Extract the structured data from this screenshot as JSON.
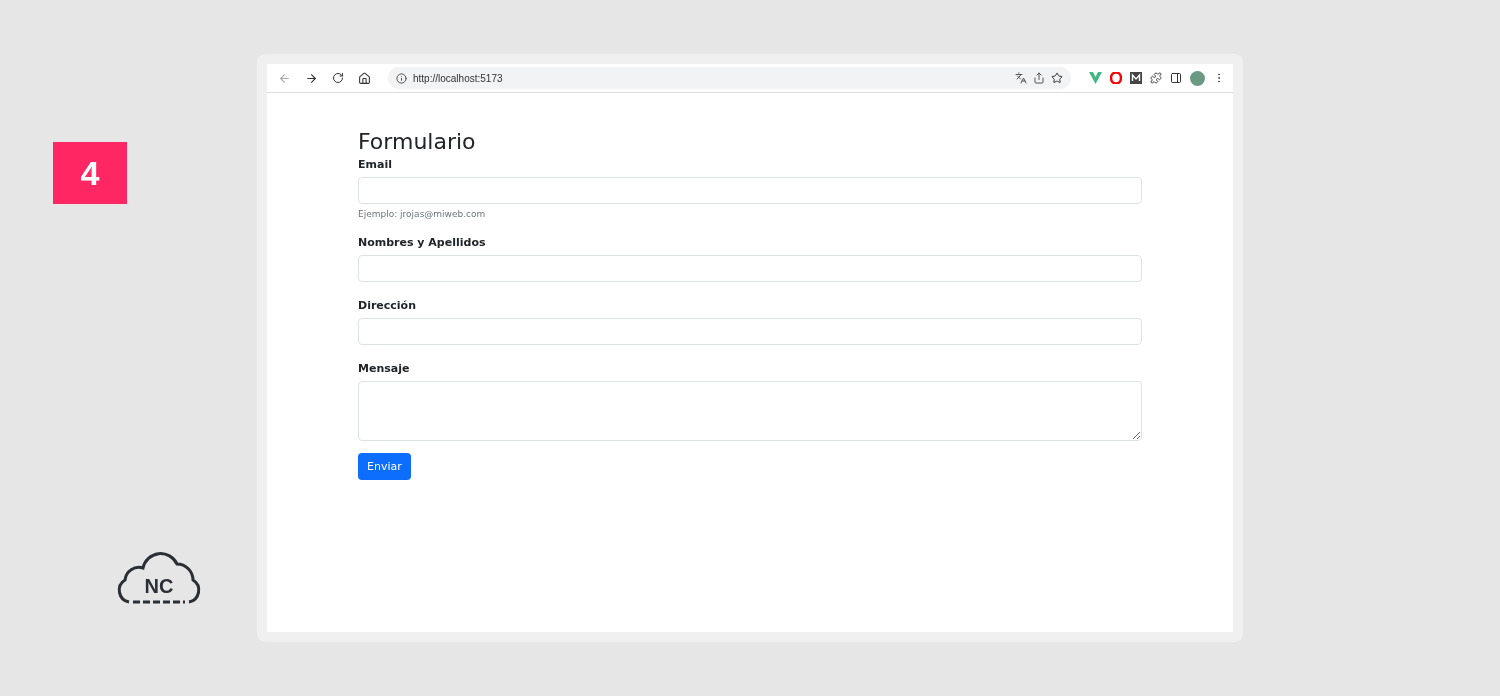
{
  "step_badge": "4",
  "logo": {
    "text": "NC"
  },
  "browser": {
    "url": "http://localhost:5173"
  },
  "form": {
    "title": "Formulario",
    "fields": [
      {
        "kind": "input",
        "label": "Email",
        "hint": "Ejemplo: jrojas@miweb.com"
      },
      {
        "kind": "input",
        "label": "Nombres y Apellidos"
      },
      {
        "kind": "input",
        "label": "Dirección"
      },
      {
        "kind": "textarea",
        "label": "Mensaje"
      }
    ],
    "submit": "Enviar"
  }
}
